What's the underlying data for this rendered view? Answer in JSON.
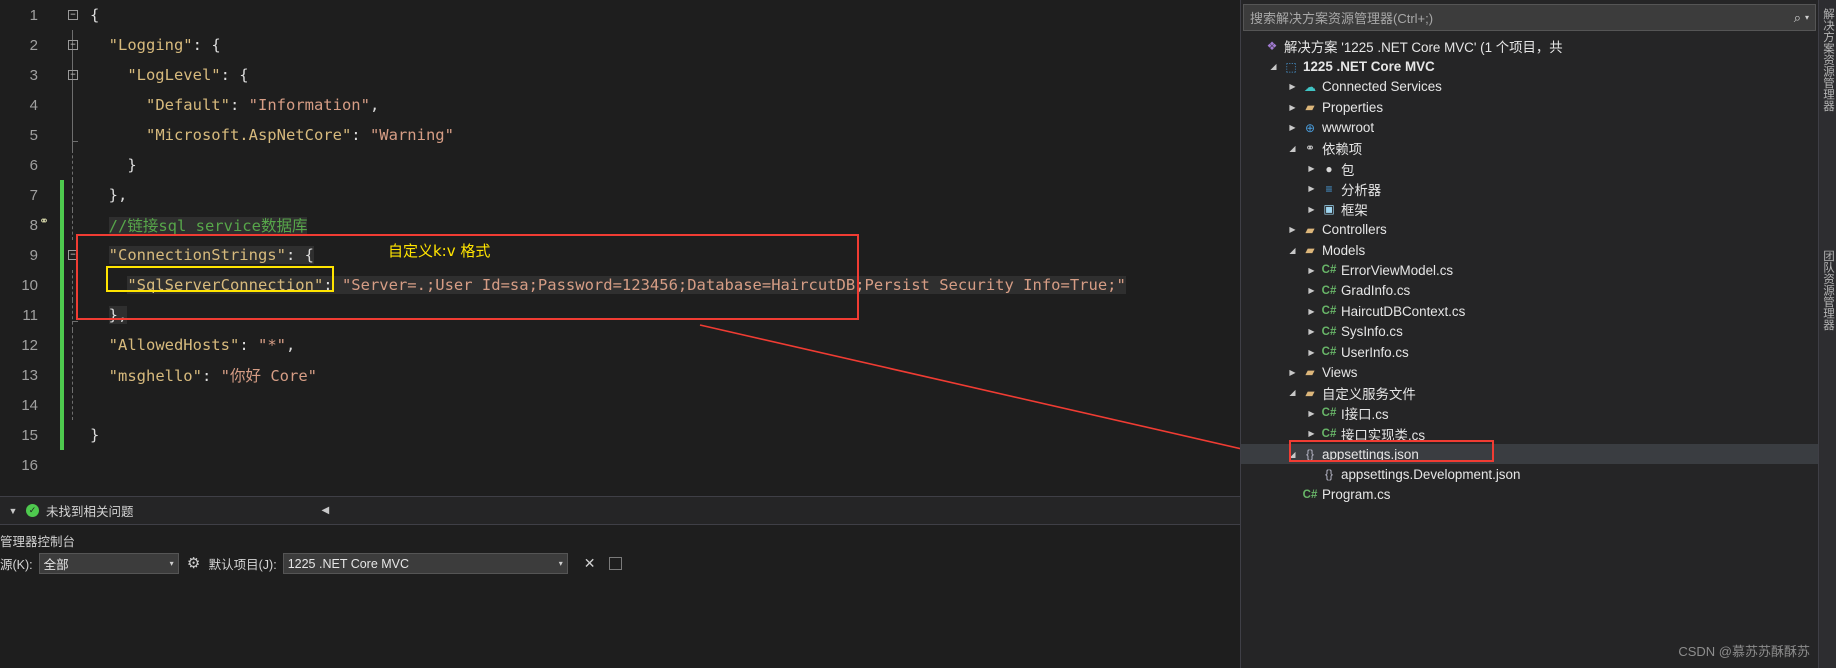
{
  "editor": {
    "lines": [
      {
        "num": "1",
        "fold": "minus",
        "indent": 0,
        "text": "{"
      },
      {
        "num": "2",
        "fold": "minus",
        "indent": 1,
        "text": "\"Logging\": {"
      },
      {
        "num": "3",
        "fold": "minus",
        "indent": 2,
        "text": "\"LogLevel\": {"
      },
      {
        "num": "4",
        "fold": "none",
        "indent": 3,
        "text": "\"Default\": \"Information\","
      },
      {
        "num": "5",
        "fold": "none",
        "indent": 3,
        "text": "\"Microsoft.AspNetCore\": \"Warning\""
      },
      {
        "num": "6",
        "fold": "none",
        "indent": 2,
        "text": "}"
      },
      {
        "num": "7",
        "fold": "none",
        "indent": 1,
        "text": "},"
      },
      {
        "num": "8",
        "fold": "none",
        "indent": 1,
        "text": "//链接sql service数据库"
      },
      {
        "num": "9",
        "fold": "minus",
        "indent": 1,
        "text": "\"ConnectionStrings\": {"
      },
      {
        "num": "10",
        "fold": "none",
        "indent": 2,
        "text": "\"SqlServerConnection\": \"Server=.;User Id=sa;Password=123456;Database=HaircutDB;Persist Security Info=True;\""
      },
      {
        "num": "11",
        "fold": "none",
        "indent": 1,
        "text": "},"
      },
      {
        "num": "12",
        "fold": "none",
        "indent": 1,
        "text": "\"AllowedHosts\": \"*\","
      },
      {
        "num": "13",
        "fold": "none",
        "indent": 1,
        "text": "\"msghello\": \"你好 Core\""
      },
      {
        "num": "14",
        "fold": "none",
        "indent": 1,
        "text": ""
      },
      {
        "num": "15",
        "fold": "none",
        "indent": 0,
        "text": "}"
      },
      {
        "num": "16",
        "fold": "none",
        "indent": 0,
        "text": ""
      }
    ],
    "tokens": {
      "comment_line8": "//链接sql service数据库",
      "key_logging": "\"Logging\"",
      "key_loglevel": "\"LogLevel\"",
      "key_default": "\"Default\"",
      "val_information": "\"Information\"",
      "key_microsoft": "\"Microsoft.AspNetCore\"",
      "val_warning": "\"Warning\"",
      "key_connstrings": "\"ConnectionStrings\"",
      "key_sqlserverconnection": "\"SqlServerConnection\"",
      "val_connectionstring": "\"Server=.;User Id=sa;Password=123456;Database=HaircutDB;Persist Security Info=True;\"",
      "key_allowedhosts": "\"AllowedHosts\"",
      "val_star": "\"*\"",
      "key_msghello": "\"msghello\"",
      "val_nihao": "\"你好 Core\""
    }
  },
  "annotations": {
    "kv_note": "自定义k:v 格式",
    "red_box_color": "#f03c33",
    "yellow_box_color": "#ffe400"
  },
  "error_list": {
    "status_text": "未找到相关问题",
    "ok_glyph": "✓",
    "collapse_glyph": "◀",
    "dropdown_glyph": "▼"
  },
  "package_manager_console": {
    "title": "管理器控制台",
    "source_label": "源(K):",
    "source_value": "全部",
    "project_label": "默认项目(J):",
    "project_value": "1225 .NET Core MVC",
    "gear_glyph": "⚙",
    "clear_glyph": "✕",
    "caret_glyph": "▾"
  },
  "solution_explorer": {
    "search_placeholder": "搜索解决方案资源管理器(Ctrl+;)",
    "search_icon": "⌕",
    "search_caret": "▾",
    "vertical_tab_1": "解决方案资源管理器",
    "vertical_tab_2": "团队资源管理器",
    "tree": [
      {
        "depth": 0,
        "arrow": "none",
        "icon": "vsnode",
        "icon_glyph": "❖",
        "label": "解决方案 '1225 .NET Core MVC' (1 个项目，共",
        "bold": false
      },
      {
        "depth": 1,
        "arrow": "expanded",
        "icon": "proj",
        "icon_glyph": "⬚",
        "label": "1225 .NET Core MVC",
        "bold": true
      },
      {
        "depth": 2,
        "arrow": "collapsed",
        "icon": "cloud",
        "icon_glyph": "☁",
        "label": "Connected Services",
        "bold": false
      },
      {
        "depth": 2,
        "arrow": "collapsed",
        "icon": "props",
        "icon_glyph": "▰",
        "label": "Properties",
        "bold": false
      },
      {
        "depth": 2,
        "arrow": "collapsed",
        "icon": "globe",
        "icon_glyph": "⊕",
        "label": "wwwroot",
        "bold": false
      },
      {
        "depth": 2,
        "arrow": "expanded",
        "icon": "deps",
        "icon_glyph": "⚭",
        "label": "依赖项",
        "bold": false
      },
      {
        "depth": 3,
        "arrow": "collapsed",
        "icon": "pkg",
        "icon_glyph": "●",
        "label": "包",
        "bold": false
      },
      {
        "depth": 3,
        "arrow": "collapsed",
        "icon": "anlz",
        "icon_glyph": "≡",
        "label": "分析器",
        "bold": false
      },
      {
        "depth": 3,
        "arrow": "collapsed",
        "icon": "fw",
        "icon_glyph": "▣",
        "label": "框架",
        "bold": false
      },
      {
        "depth": 2,
        "arrow": "collapsed",
        "icon": "folder",
        "icon_glyph": "▰",
        "label": "Controllers",
        "bold": false
      },
      {
        "depth": 2,
        "arrow": "expanded",
        "icon": "folder",
        "icon_glyph": "▰",
        "label": "Models",
        "bold": false
      },
      {
        "depth": 3,
        "arrow": "collapsed",
        "icon": "cs",
        "icon_glyph": "C#",
        "label": "ErrorViewModel.cs",
        "bold": false
      },
      {
        "depth": 3,
        "arrow": "collapsed",
        "icon": "cs",
        "icon_glyph": "C#",
        "label": "GradInfo.cs",
        "bold": false
      },
      {
        "depth": 3,
        "arrow": "collapsed",
        "icon": "cs",
        "icon_glyph": "C#",
        "label": "HaircutDBContext.cs",
        "bold": false
      },
      {
        "depth": 3,
        "arrow": "collapsed",
        "icon": "cs",
        "icon_glyph": "C#",
        "label": "SysInfo.cs",
        "bold": false
      },
      {
        "depth": 3,
        "arrow": "collapsed",
        "icon": "cs",
        "icon_glyph": "C#",
        "label": "UserInfo.cs",
        "bold": false
      },
      {
        "depth": 2,
        "arrow": "collapsed",
        "icon": "folder",
        "icon_glyph": "▰",
        "label": "Views",
        "bold": false
      },
      {
        "depth": 2,
        "arrow": "expanded",
        "icon": "folder",
        "icon_glyph": "▰",
        "label": "自定义服务文件",
        "bold": false
      },
      {
        "depth": 3,
        "arrow": "collapsed",
        "icon": "cs",
        "icon_glyph": "C#",
        "label": "I接口.cs",
        "bold": false
      },
      {
        "depth": 3,
        "arrow": "collapsed",
        "icon": "cs",
        "icon_glyph": "C#",
        "label": "接口实现类.cs",
        "bold": false
      },
      {
        "depth": 2,
        "arrow": "expanded",
        "icon": "json",
        "icon_glyph": "{}",
        "label": "appsettings.json",
        "bold": false,
        "selected": true
      },
      {
        "depth": 3,
        "arrow": "none",
        "icon": "json",
        "icon_glyph": "{}",
        "label": "appsettings.Development.json",
        "bold": false
      },
      {
        "depth": 2,
        "arrow": "none",
        "icon": "cs",
        "icon_glyph": "C#",
        "label": "Program.cs",
        "bold": false
      }
    ]
  },
  "watermark": {
    "text": "CSDN @慕苏苏酥酥苏"
  }
}
